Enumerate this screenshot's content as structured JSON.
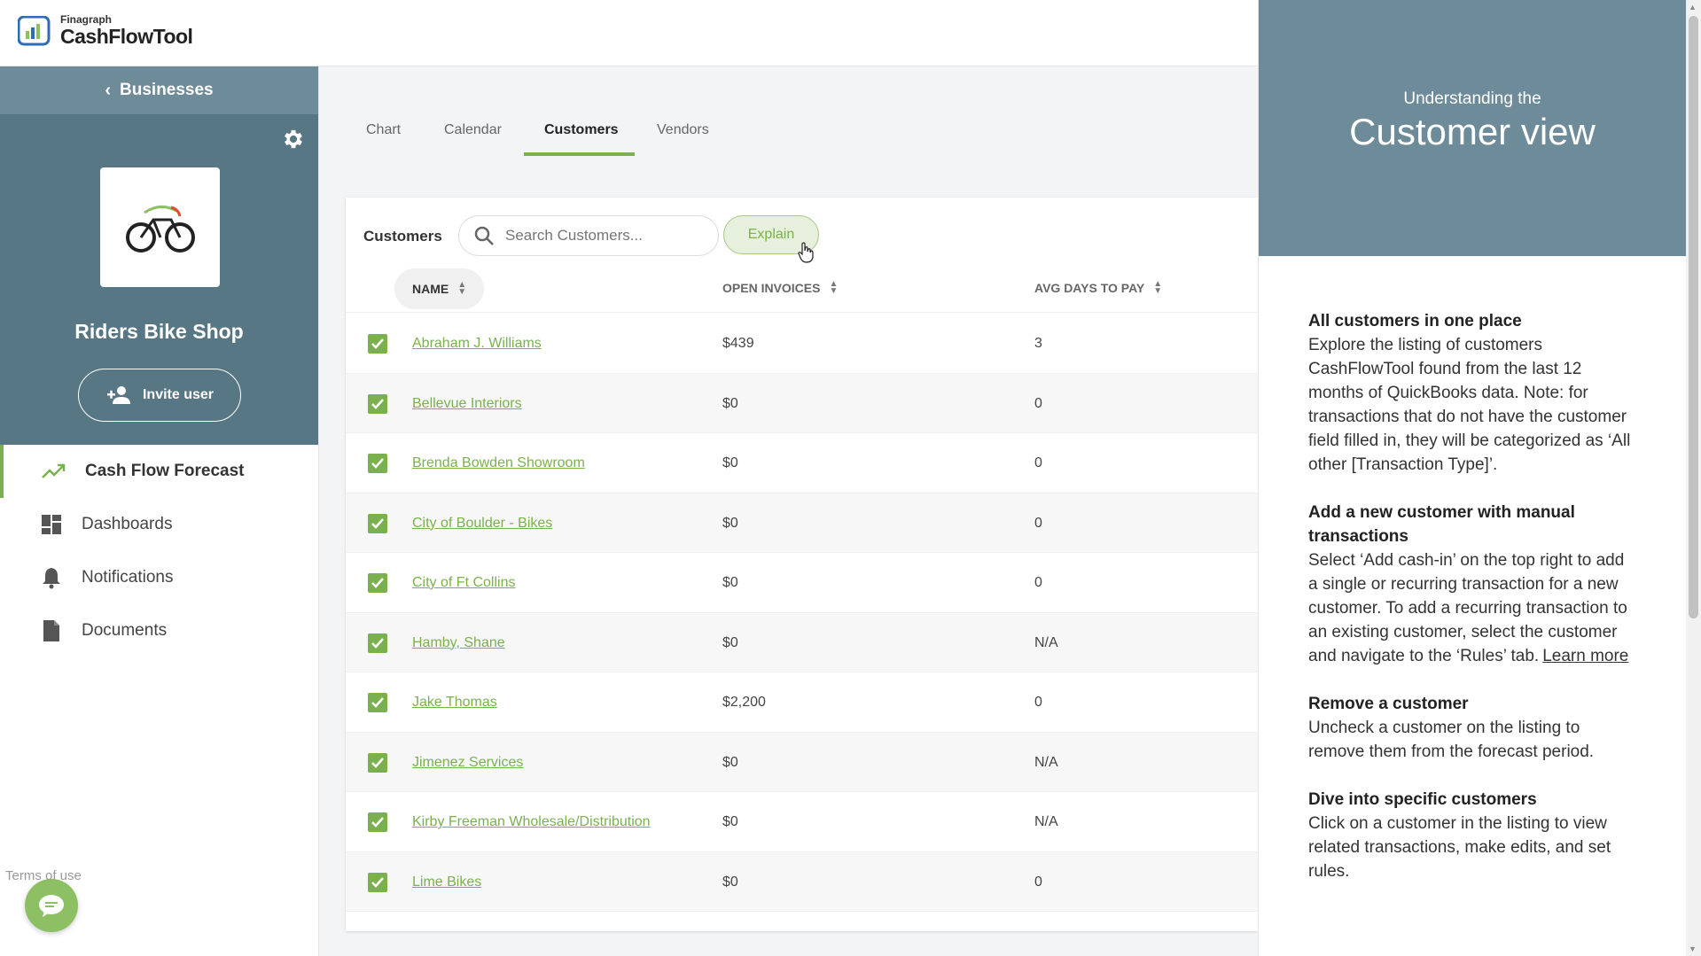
{
  "app": {
    "brand_small": "Finagraph",
    "brand_big": "CashFlowTool"
  },
  "sidebar": {
    "back_label": "Businesses",
    "business_name": "Riders Bike Shop",
    "invite_label": "Invite user",
    "nav": [
      {
        "label": "Cash Flow Forecast",
        "icon": "trending-up-icon"
      },
      {
        "label": "Dashboards",
        "icon": "dashboard-icon"
      },
      {
        "label": "Notifications",
        "icon": "bell-icon"
      },
      {
        "label": "Documents",
        "icon": "document-icon"
      }
    ],
    "terms": "Terms of use"
  },
  "tabs": [
    {
      "label": "Chart"
    },
    {
      "label": "Calendar"
    },
    {
      "label": "Customers"
    },
    {
      "label": "Vendors"
    }
  ],
  "customers": {
    "title": "Customers",
    "search_placeholder": "Search Customers...",
    "explain_label": "Explain",
    "columns": {
      "name": "NAME",
      "open": "OPEN INVOICES",
      "avg": "AVG DAYS TO PAY"
    },
    "rows": [
      {
        "name": "Abraham J. Williams",
        "open": "$439",
        "avg": "3"
      },
      {
        "name": "Bellevue Interiors",
        "open": "$0",
        "avg": "0"
      },
      {
        "name": "Brenda Bowden Showroom",
        "open": "$0",
        "avg": "0"
      },
      {
        "name": "City of Boulder - Bikes",
        "open": "$0",
        "avg": "0"
      },
      {
        "name": "City of Ft Collins",
        "open": "$0",
        "avg": "0"
      },
      {
        "name": "Hamby, Shane",
        "open": "$0",
        "avg": "N/A"
      },
      {
        "name": "Jake Thomas",
        "open": "$2,200",
        "avg": "0"
      },
      {
        "name": "Jimenez Services",
        "open": "$0",
        "avg": "N/A"
      },
      {
        "name": "Kirby Freeman Wholesale/Distribution",
        "open": "$0",
        "avg": "N/A"
      },
      {
        "name": "Lime Bikes",
        "open": "$0",
        "avg": "0"
      }
    ]
  },
  "help": {
    "subtitle": "Understanding the",
    "title": "Customer view",
    "sections": [
      {
        "heading": "All customers in one place",
        "text": "Explore the listing of customers CashFlowTool found from the last 12 months of QuickBooks data. Note: for transactions that do not have the customer field filled in, they will be categorized as ‘All other [Transaction Type]’."
      },
      {
        "heading": "Add a new customer with manual transactions",
        "text": "Select ‘Add cash-in’ on the top right to add a single or recurring transaction for a new customer. To add a recurring transaction to an existing customer, select the customer and navigate to the ‘Rules’ tab.",
        "link": "Learn more"
      },
      {
        "heading": "Remove a customer",
        "text": "Uncheck a customer on the listing to remove them from the forecast period."
      },
      {
        "heading": "Dive into specific customers",
        "text": "Click on a customer in the listing to view related transactions, make edits, and set rules."
      }
    ]
  },
  "colors": {
    "accent": "#7ab14e",
    "slate": "#587784",
    "slate_light": "#6e8b99"
  }
}
